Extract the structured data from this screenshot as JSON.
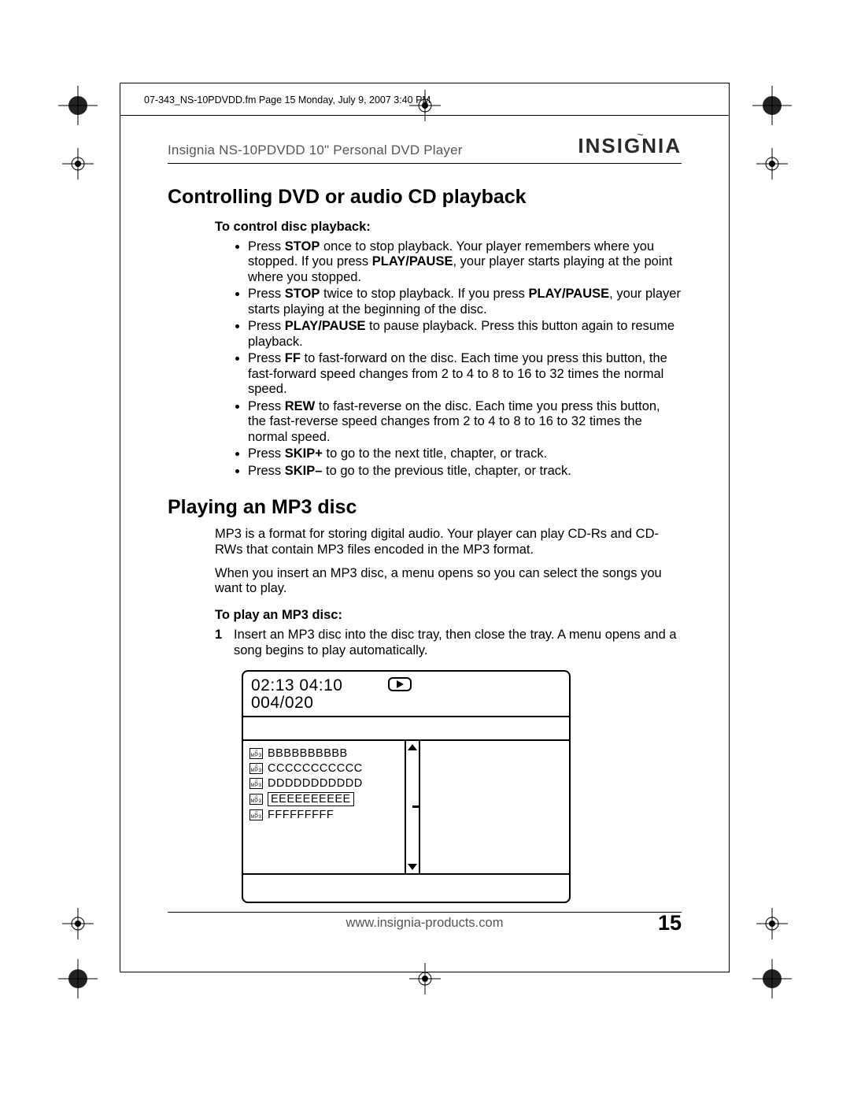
{
  "meta": {
    "line": "07-343_NS-10PDVDD.fm  Page 15  Monday, July 9, 2007  3:40 PM"
  },
  "header": {
    "product": "Insignia NS-10PDVDD 10\" Personal DVD Player",
    "brand": "INSIGNIA"
  },
  "sec1": {
    "title": "Controlling DVD or audio CD playback",
    "subtitle": "To control disc playback:",
    "items": [
      {
        "pre": "Press ",
        "b1": "STOP",
        "mid": " once to stop playback. Your player remembers where you stopped. If you press ",
        "b2": "PLAY/PAUSE",
        "post": ", your player starts playing at the point where you stopped."
      },
      {
        "pre": "Press ",
        "b1": "STOP",
        "mid": " twice to stop playback. If you press ",
        "b2": "PLAY/PAUSE",
        "post": ", your player starts playing at the beginning of the disc."
      },
      {
        "pre": "Press ",
        "b1": "PLAY/PAUSE",
        "mid": " to pause playback. Press this button again to resume playback.",
        "b2": "",
        "post": ""
      },
      {
        "pre": "Press ",
        "b1": "FF",
        "mid": " to fast-forward on the disc. Each time you press this button, the fast-forward speed changes from 2 to 4 to 8 to 16 to 32 times the normal speed.",
        "b2": "",
        "post": ""
      },
      {
        "pre": "Press ",
        "b1": "REW",
        "mid": " to fast-reverse on the disc. Each time you press this button, the fast-reverse speed changes from 2 to 4 to 8 to 16 to 32 times the normal speed.",
        "b2": "",
        "post": ""
      },
      {
        "pre": "Press ",
        "b1": "SKIP+",
        "mid": " to go to the next title, chapter, or track.",
        "b2": "",
        "post": ""
      },
      {
        "pre": "Press ",
        "b1": "SKIP–",
        "mid": " to go to the previous title, chapter, or track.",
        "b2": "",
        "post": ""
      }
    ]
  },
  "sec2": {
    "title": "Playing an MP3 disc",
    "para1": "MP3 is a format for storing digital audio. Your player can play CD-Rs and CD-RWs that contain MP3 files encoded in the MP3 format.",
    "para2": "When you insert an MP3 disc, a menu opens so you can select the songs you want to play.",
    "subtitle": "To play an MP3 disc:",
    "step1_num": "1",
    "step1": "Insert an MP3 disc into the disc tray, then close the tray. A menu opens and a song begins to play automatically."
  },
  "figure": {
    "time": "02:13 04:10",
    "track": "004/020",
    "icon_label": "MP3",
    "rows": [
      {
        "txt": "BBBBBBBBBB",
        "sel": false
      },
      {
        "txt": "CCCCCCCCCCC",
        "sel": false
      },
      {
        "txt": "DDDDDDDDDDD",
        "sel": false
      },
      {
        "txt": "EEEEEEEEEE",
        "sel": true
      },
      {
        "txt": "FFFFFFFFF",
        "sel": false
      }
    ]
  },
  "footer": {
    "url": "www.insignia-products.com",
    "page": "15"
  }
}
